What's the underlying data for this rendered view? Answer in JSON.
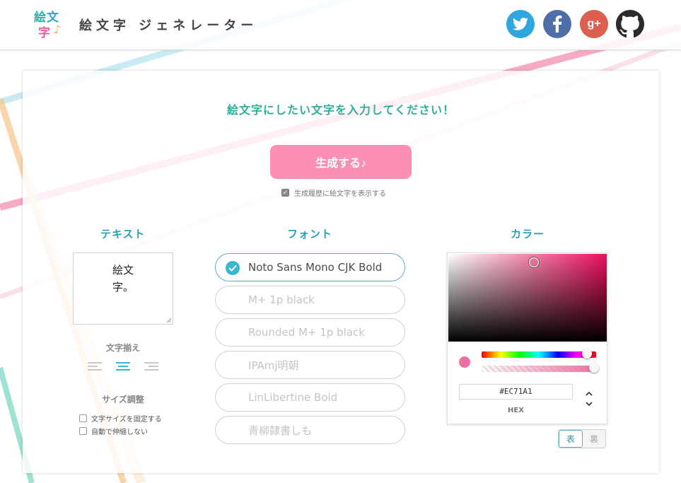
{
  "header": {
    "logo": {
      "chars": [
        "絵",
        "文",
        "字",
        "♪"
      ]
    },
    "title": "絵文字 ジェネレーター",
    "social": [
      {
        "name": "twitter",
        "icon": "twitter-bird-icon",
        "color": "#2ea6de"
      },
      {
        "name": "facebook",
        "icon": "facebook-f-icon",
        "color": "#4e6ea7"
      },
      {
        "name": "google-plus",
        "icon": "google-plus-icon",
        "color": "#dd5f4f"
      },
      {
        "name": "github",
        "icon": "github-octocat-icon",
        "color": "#2b2b2b"
      }
    ],
    "gplus_label": "g+"
  },
  "main": {
    "prompt": "絵文字にしたい文字を入力してください！",
    "generate_label": "生成する♪",
    "history_label": "生成履歴に絵文字を表示する",
    "history_checked": true,
    "accent_color": "#fb90b4"
  },
  "text_section": {
    "title": "テキスト",
    "value": "絵文\n字。",
    "align_title": "文字揃え",
    "align_options": [
      "left",
      "center",
      "right"
    ],
    "align_selected": "center",
    "size_title": "サイズ調整",
    "size_options": [
      {
        "label": "文字サイズを固定する",
        "checked": false
      },
      {
        "label": "自動で伸縮しない",
        "checked": false
      }
    ]
  },
  "font_section": {
    "title": "フォント",
    "fonts": [
      {
        "label": "Noto Sans Mono CJK Bold",
        "selected": true
      },
      {
        "label": "M+ 1p black",
        "selected": false
      },
      {
        "label": "Rounded M+ 1p black",
        "selected": false
      },
      {
        "label": "IPAmj明朝",
        "selected": false
      },
      {
        "label": "LinLibertine Bold",
        "selected": false
      },
      {
        "label": "青柳隷書しも",
        "selected": false
      }
    ]
  },
  "color_section": {
    "title": "カラー",
    "hex_value": "#EC71A1",
    "hex_label": "HEX",
    "current_color": "#ec71a1",
    "side_options": {
      "front": "表",
      "back": "裏"
    },
    "side_selected": "front"
  }
}
